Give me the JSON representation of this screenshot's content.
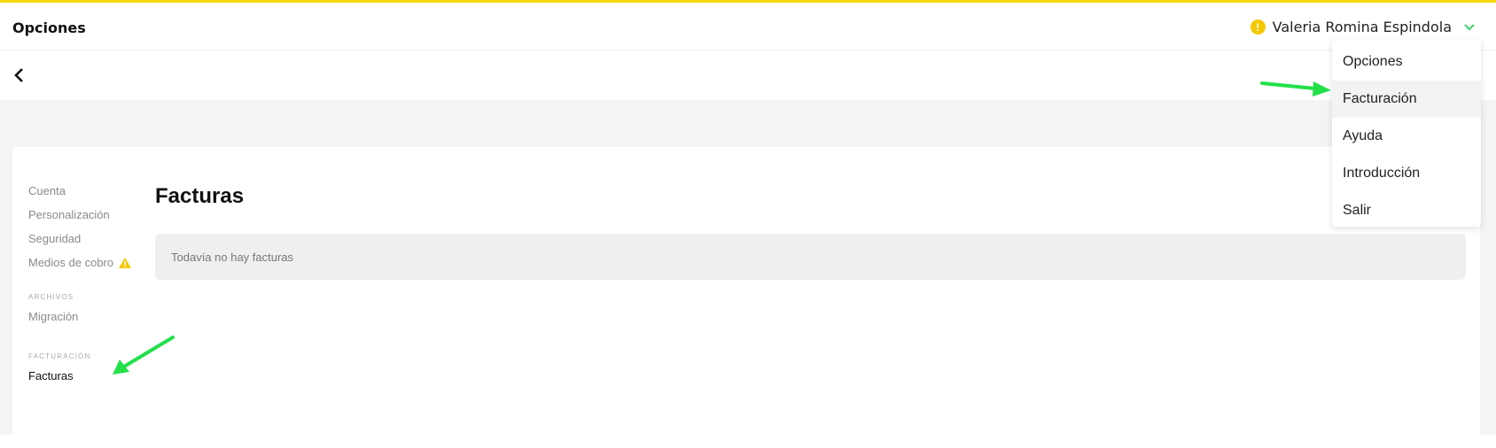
{
  "header": {
    "title": "Opciones",
    "user_name": "Valeria Romina Espindola",
    "alert_symbol": "!",
    "accent_color": "#f5d90a",
    "chevron_color": "#3ccf6e"
  },
  "sidebar": {
    "items": [
      {
        "label": "Cuenta"
      },
      {
        "label": "Personalización"
      },
      {
        "label": "Seguridad"
      },
      {
        "label": "Medios de cobro",
        "icon": "warning-icon"
      }
    ],
    "section_archivos": "ARCHIVOS",
    "archivos_items": [
      {
        "label": "Migración"
      }
    ],
    "section_facturacion": "FACTURACIÓN",
    "facturacion_items": [
      {
        "label": "Facturas"
      }
    ]
  },
  "main": {
    "title": "Facturas",
    "empty_message": "Todavía no hay facturas"
  },
  "dropdown": {
    "items": [
      {
        "label": "Opciones"
      },
      {
        "label": "Facturación"
      },
      {
        "label": "Ayuda"
      },
      {
        "label": "Introducción"
      },
      {
        "label": "Salir"
      }
    ]
  },
  "annotations": {
    "arrow_color": "#22e04a"
  }
}
